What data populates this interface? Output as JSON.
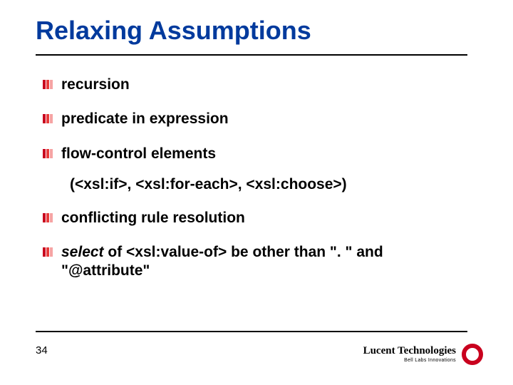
{
  "title": "Relaxing Assumptions",
  "bullets": {
    "b1": "recursion",
    "b2": "predicate in expression",
    "b3": "flow-control elements",
    "b3_sub": "(<xsl:if>, <xsl:for-each>, <xsl:choose>)",
    "b4": "conflicting rule resolution",
    "b5_emph": "select",
    "b5_rest": " of <xsl:value-of> be other than \". \" and \"@attribute\""
  },
  "page_number": "34",
  "brand": {
    "name": "Lucent Technologies",
    "tagline": "Bell Labs Innovations"
  }
}
